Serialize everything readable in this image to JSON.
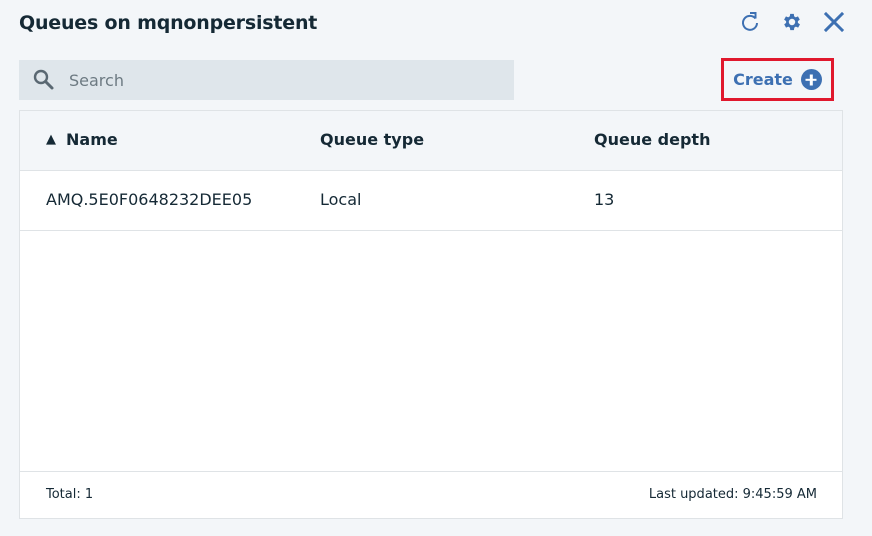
{
  "title": "Queues on mqnonpersistent",
  "header_icons": {
    "refresh": "refresh-icon",
    "settings": "gear-icon",
    "close": "close-icon"
  },
  "search": {
    "placeholder": "Search",
    "value": "",
    "icon": "search-icon"
  },
  "create": {
    "label": "Create",
    "icon": "plus-circle-icon"
  },
  "table": {
    "sort_indicator": "▲",
    "columns": [
      {
        "label": "Name",
        "sorted": "ascending"
      },
      {
        "label": "Queue type"
      },
      {
        "label": "Queue depth"
      }
    ],
    "rows": [
      {
        "name": "AMQ.5E0F0648232DEE05",
        "type": "Local",
        "depth": "13"
      }
    ]
  },
  "footer": {
    "total": "Total: 1",
    "last_updated": "Last updated: 9:45:59 AM"
  },
  "colors": {
    "accent": "#3d70b2",
    "highlight_border": "#e0182d",
    "text": "#152935",
    "background": "#f3f6f9"
  }
}
